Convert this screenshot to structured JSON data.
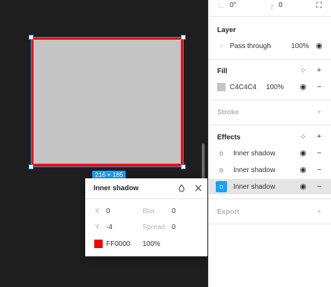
{
  "canvas": {
    "size_label": "216 × 185"
  },
  "popover": {
    "title": "Inner shadow",
    "x_label": "X",
    "x_value": "0",
    "y_label": "Y",
    "y_value": "-4",
    "blur_label": "Blur",
    "blur_value": "0",
    "spread_label": "Spread",
    "spread_value": "0",
    "color_hex": "FF0000",
    "opacity": "100%"
  },
  "panel": {
    "top": {
      "rotation": "0°",
      "radius": "0"
    },
    "layer": {
      "title": "Layer",
      "blend_mode": "Pass through",
      "opacity": "100%"
    },
    "fill": {
      "title": "Fill",
      "hex": "C4C4C4",
      "opacity": "100%"
    },
    "stroke": {
      "title": "Stroke"
    },
    "effects": {
      "title": "Effects",
      "items": [
        {
          "label": "Inner shadow"
        },
        {
          "label": "Inner shadow"
        },
        {
          "label": "Inner shadow"
        }
      ]
    },
    "export": {
      "title": "Export"
    }
  },
  "colors": {
    "accent": "#18a0fb",
    "shadow": "#ff0000",
    "fill": "#c4c4c4"
  }
}
